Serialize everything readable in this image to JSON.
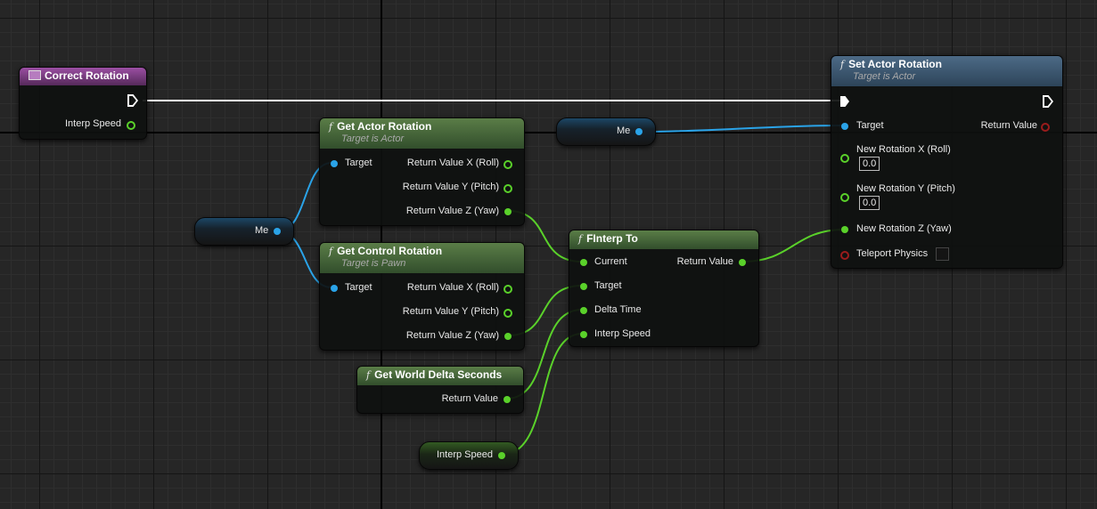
{
  "nodes": {
    "correct_rotation": {
      "title": "Correct Rotation",
      "pins": {
        "interp_speed": "Interp Speed"
      }
    },
    "get_actor_rotation": {
      "title": "Get Actor Rotation",
      "subtitle": "Target is Actor",
      "pins": {
        "target": "Target",
        "return_x": "Return Value X (Roll)",
        "return_y": "Return Value Y (Pitch)",
        "return_z": "Return Value Z (Yaw)"
      }
    },
    "get_control_rotation": {
      "title": "Get Control Rotation",
      "subtitle": "Target is Pawn",
      "pins": {
        "target": "Target",
        "return_x": "Return Value X (Roll)",
        "return_y": "Return Value Y (Pitch)",
        "return_z": "Return Value Z (Yaw)"
      }
    },
    "get_world_delta_seconds": {
      "title": "Get World Delta Seconds",
      "pins": {
        "return_value": "Return Value"
      }
    },
    "finterp_to": {
      "title": "FInterp To",
      "pins": {
        "current": "Current",
        "target": "Target",
        "delta_time": "Delta Time",
        "interp_speed": "Interp Speed",
        "return_value": "Return Value"
      }
    },
    "set_actor_rotation": {
      "title": "Set Actor Rotation",
      "subtitle": "Target is Actor",
      "pins": {
        "target": "Target",
        "return_value": "Return Value",
        "new_rotation_x": "New Rotation X (Roll)",
        "new_rotation_x_value": "0.0",
        "new_rotation_y": "New Rotation Y (Pitch)",
        "new_rotation_y_value": "0.0",
        "new_rotation_z": "New Rotation Z (Yaw)",
        "teleport_physics": "Teleport Physics"
      }
    }
  },
  "variables": {
    "me_top": "Me",
    "me_left": "Me",
    "interp_speed": "Interp Speed"
  },
  "function_icon": "f",
  "colors": {
    "float_pin": "#5ad12a",
    "object_pin": "#2aa3e8",
    "bool_pin": "#9a1c1c",
    "exec_wire": "#ffffff",
    "function_header": "#4a6b3c",
    "target_function_header": "#3d5873",
    "event_header": "#7a3c82"
  }
}
